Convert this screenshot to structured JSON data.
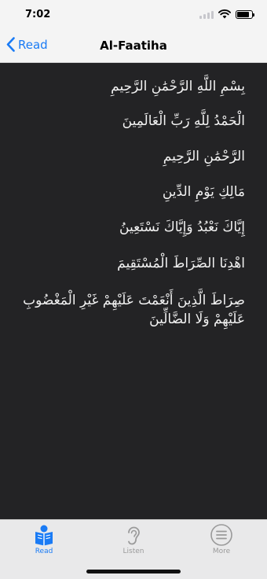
{
  "status": {
    "time": "7:02",
    "battery_level": 0.85
  },
  "nav": {
    "back_label": "Read",
    "title": "Al-Faatiha"
  },
  "verses": [
    "بِسْمِ اللَّهِ الرَّحْمَٰنِ الرَّحِيمِ",
    "الْحَمْدُ لِلَّهِ رَبِّ الْعَالَمِينَ",
    "الرَّحْمَٰنِ الرَّحِيمِ",
    "مَالِكِ يَوْمِ الدِّينِ",
    "إِيَّاكَ نَعْبُدُ وَإِيَّاكَ نَسْتَعِينُ",
    "اهْدِنَا الصِّرَاطَ الْمُسْتَقِيمَ",
    "صِرَاطَ الَّذِينَ أَنْعَمْتَ عَلَيْهِمْ غَيْرِ الْمَغْضُوبِ عَلَيْهِمْ وَلَا الضَّالِّينَ"
  ],
  "tabs": [
    {
      "label": "Read",
      "icon": "reader-icon",
      "active": true
    },
    {
      "label": "Listen",
      "icon": "ear-icon",
      "active": false
    },
    {
      "label": "More",
      "icon": "more-icon",
      "active": false
    }
  ],
  "colors": {
    "accent": "#1a7bf5",
    "content_bg": "#232325",
    "verse_text": "#f2f2f2",
    "tab_inactive": "#9a9a9a"
  }
}
